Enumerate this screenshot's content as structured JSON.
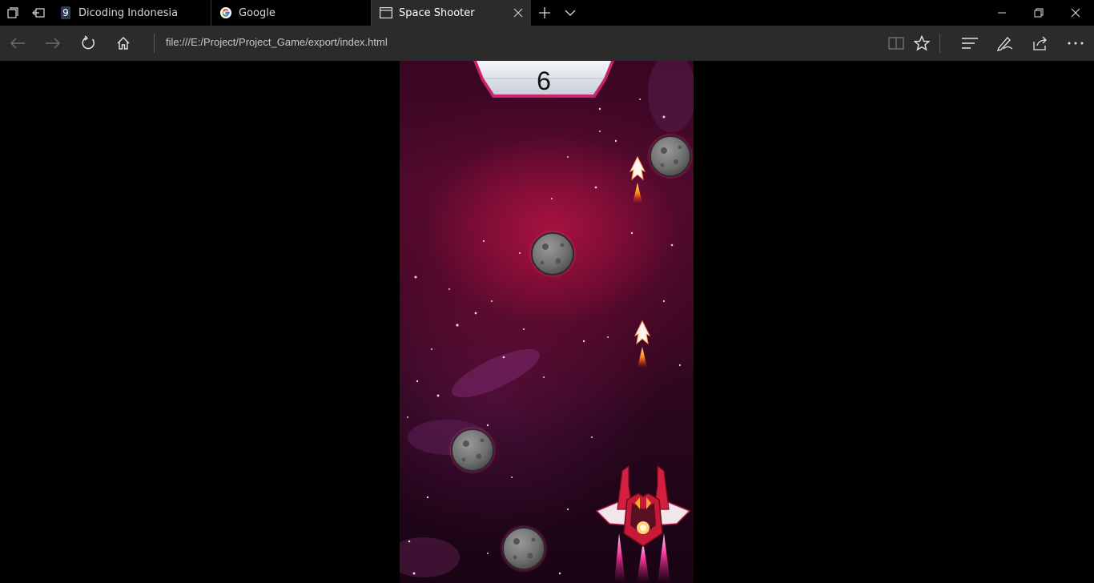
{
  "browser": {
    "tabs": [
      {
        "label": "Dicoding Indonesia",
        "favicon": "dicoding-icon",
        "active": false
      },
      {
        "label": "Google",
        "favicon": "google-icon",
        "active": false
      },
      {
        "label": "Space Shooter",
        "favicon": "page-icon",
        "active": true
      }
    ],
    "address": "file:///E:/Project/Project_Game/export/index.html"
  },
  "game": {
    "score": "6",
    "colors": {
      "accent": "#e0287a",
      "background": "#3a0622"
    }
  }
}
